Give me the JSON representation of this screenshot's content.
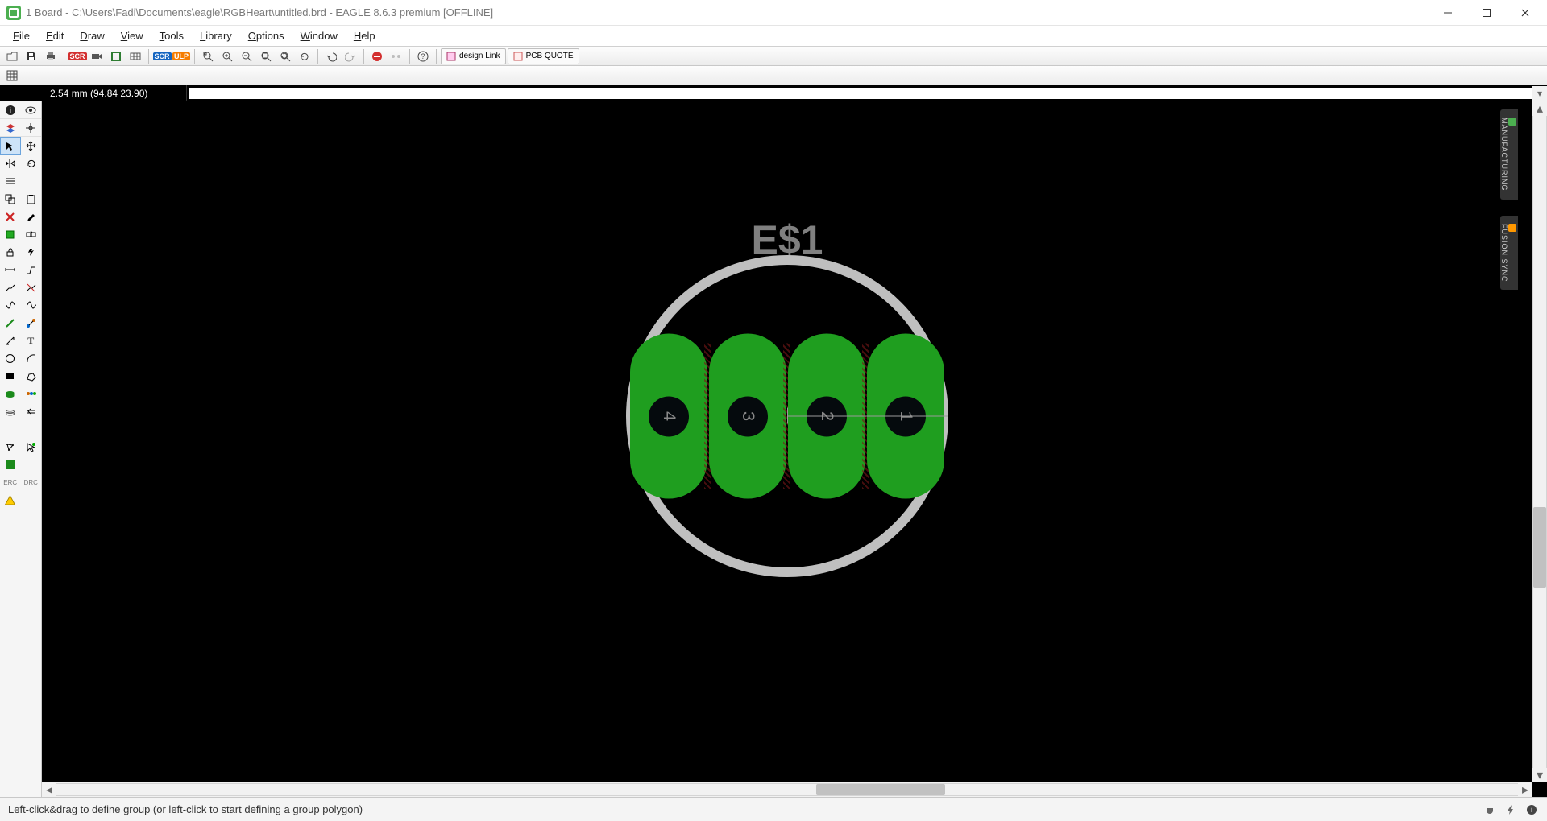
{
  "window": {
    "title": "1 Board - C:\\Users\\Fadi\\Documents\\eagle\\RGBHeart\\untitled.brd - EAGLE 8.6.3 premium [OFFLINE]"
  },
  "menu": {
    "file": "File",
    "edit": "Edit",
    "draw": "Draw",
    "view": "View",
    "tools": "Tools",
    "library": "Library",
    "options": "Options",
    "window": "Window",
    "help": "Help"
  },
  "toolbar_badges": {
    "scr": "SCR",
    "scr2": "SCR",
    "ulp": "ULP"
  },
  "extbtns": {
    "design_link": "design Link",
    "pcb_quote": "PCB QUOTE"
  },
  "coords": "2.54 mm (94.84 23.90)",
  "component": {
    "label": "E$1",
    "pads": [
      "4",
      "3",
      "2",
      "1"
    ]
  },
  "right_tabs": {
    "manufacturing": "MANUFACTURING",
    "fusion": "FUSION SYNC"
  },
  "status": "Left-click&drag to define group (or left-click to start defining a group polygon)"
}
